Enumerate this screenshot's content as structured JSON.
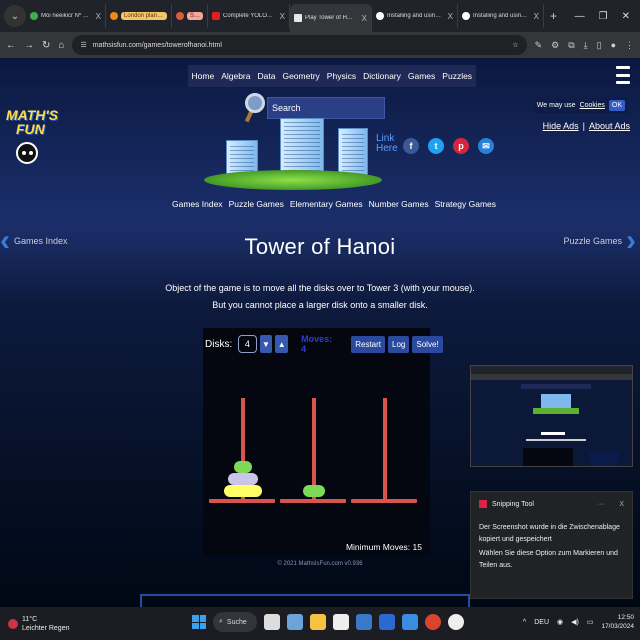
{
  "browser": {
    "tabs": [
      {
        "label": "Mói neeikicr Nº 8 - pl",
        "color": "#3fb04a",
        "style": ""
      },
      {
        "label": "London planning",
        "color": "#f08a1c",
        "style": "chip"
      },
      {
        "label": "Schule",
        "color": "#e05a3c",
        "style": "chip red"
      },
      {
        "label": "Complete YOLO v8 Cu",
        "color": "#e02020",
        "style": ""
      },
      {
        "label": "Play Tower of Hanoi",
        "color": "#e8e8e8",
        "style": "active"
      },
      {
        "label": "Installing and using Li",
        "color": "#fff",
        "style": ""
      },
      {
        "label": "Installing and using Li",
        "color": "#fff",
        "style": ""
      }
    ],
    "new_tab": "+",
    "url": "mathsisfun.com/games/towerofhanoi.html"
  },
  "site": {
    "nav": [
      "Home",
      "Algebra",
      "Data",
      "Geometry",
      "Physics",
      "Dictionary",
      "Games",
      "Puzzles"
    ],
    "search_placeholder": "Search",
    "cookie_text": "We may use",
    "cookie_link": "Cookies",
    "ok": "OK",
    "hide_ads": "Hide Ads",
    "separator": "|",
    "about_ads": "About Ads",
    "logo_line1": "MATH'S",
    "logo_line2": "FUN",
    "link_here_1": "Link",
    "link_here_2": "Here",
    "game_nav": [
      "Games Index",
      "Puzzle Games",
      "Elementary Games",
      "Number Games",
      "Strategy Games"
    ],
    "left_link": "Games Index",
    "right_link": "Puzzle Games",
    "title": "Tower of Hanoi",
    "desc_line1": "Object of the game is to move all the disks over to Tower 3 (with your mouse).",
    "desc_line2": "But you cannot place a larger disk onto a smaller disk.",
    "copyright": "© 2021 MathsIsFun.com v0.936"
  },
  "game": {
    "disks_label": "Disks:",
    "disks_value": "4",
    "down": "▼",
    "up": "▲",
    "moves_label": "Moves: 4",
    "restart": "Restart",
    "log": "Log",
    "solve": "Solve!",
    "min_moves": "Minimum Moves: 15",
    "colors": {
      "pole": "#d9534f",
      "disk_small": "#7ed957",
      "disk_mid": "#c9c4e8",
      "disk_large": "#ffff66"
    }
  },
  "notification": {
    "app": "Snipping Tool",
    "more": "···",
    "close": "X",
    "line1": "Der Screenshot wurde in die Zwischenablage kopiert und gespeichert",
    "line2": "Wählen Sie diese Option zum Markieren und Teilen aus."
  },
  "taskbar": {
    "temp": "11°C",
    "weather": "Leichter Regen",
    "search": "Suche",
    "lang": "DEU",
    "time": "12:50",
    "date": "17/03/2024"
  }
}
